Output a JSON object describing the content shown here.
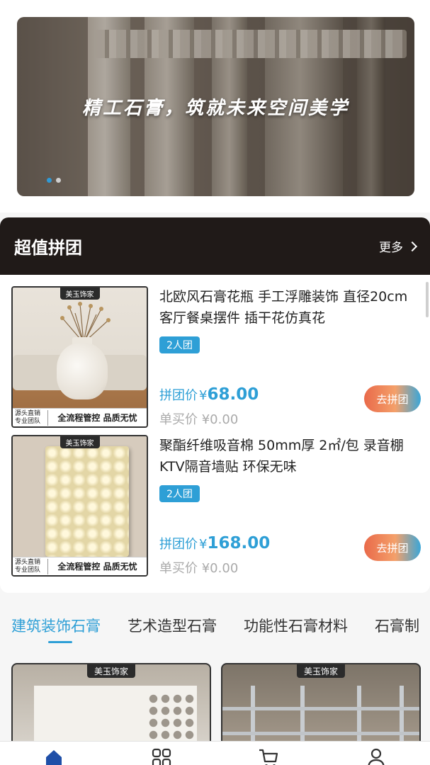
{
  "banner": {
    "slogan": "精工石膏，筑就未来空间美学",
    "slides": 2,
    "active_slide": 1
  },
  "group_buy": {
    "title": "超值拼团",
    "more_label": "更多"
  },
  "deals": [
    {
      "brand": "美玉饰家",
      "footer_left": "源头直销 专业团队",
      "footer_right": "全流程管控 品质无忧",
      "title": "北欧风石膏花瓶 手工浮雕装饰 直径20cm 客厅餐桌摆件 插干花仿真花",
      "tag": "2人团",
      "group_price_label": "拼团价",
      "currency": "¥",
      "group_price": "68.00",
      "single_price_label": "单买价",
      "single_price": "¥0.00",
      "button": "去拼团"
    },
    {
      "brand": "美玉饰家",
      "footer_left": "源头直销 专业团队",
      "footer_right": "全流程管控 品质无忧",
      "title": "聚酯纤维吸音棉 50mm厚 2㎡/包 录音棚KTV隔音墙贴 环保无味",
      "tag": "2人团",
      "group_price_label": "拼团价",
      "currency": "¥",
      "group_price": "168.00",
      "single_price_label": "单买价",
      "single_price": "¥0.00",
      "button": "去拼团"
    }
  ],
  "category_tabs": [
    {
      "label": "建筑装饰石膏",
      "active": true
    },
    {
      "label": "艺术造型石膏",
      "active": false
    },
    {
      "label": "功能性石膏材料",
      "active": false
    },
    {
      "label": "石膏制",
      "active": false
    }
  ],
  "products": [
    {
      "brand": "美玉饰家"
    },
    {
      "brand": "美玉饰家"
    }
  ],
  "nav": [
    {
      "icon": "home-icon",
      "active": true,
      "color": "#1f4fa8"
    },
    {
      "icon": "category-icon",
      "active": false,
      "color": "#333333"
    },
    {
      "icon": "cart-icon",
      "active": false,
      "color": "#333333"
    },
    {
      "icon": "user-icon",
      "active": false,
      "color": "#333333"
    }
  ],
  "colors": {
    "accent": "#2e9fd6",
    "header_bg": "#201a18"
  }
}
